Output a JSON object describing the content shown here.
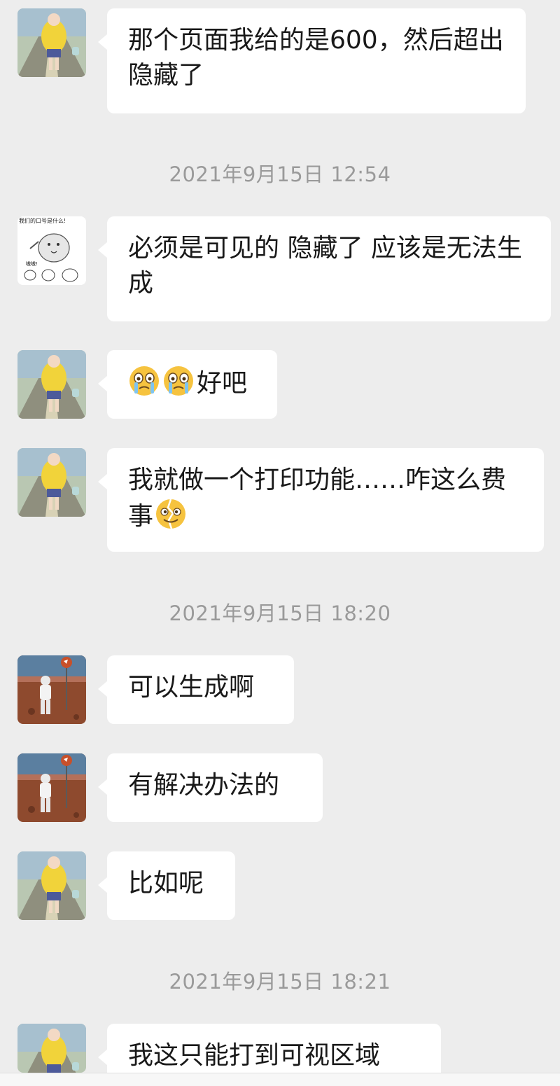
{
  "timestamps": [
    "2021年9月15日 12:54",
    "2021年9月15日 18:20",
    "2021年9月15日 18:21"
  ],
  "messages": [
    {
      "sender": "yellow-coat",
      "text": "那个页面我给的是600，然后超出隐藏了"
    },
    {
      "sender": "sticker-cat",
      "text": "必须是可见的 隐藏了  应该是无法生成"
    },
    {
      "sender": "yellow-coat",
      "emoji": [
        "cry-emoji",
        "cry-emoji"
      ],
      "text": "好吧"
    },
    {
      "sender": "yellow-coat",
      "text": "我就做一个打印功能……咋这么费事",
      "trailing_emoji": "broken-face-emoji"
    },
    {
      "sender": "astronaut",
      "text": "可以生成啊"
    },
    {
      "sender": "astronaut",
      "text": "有解决办法的"
    },
    {
      "sender": "yellow-coat",
      "text": "比如呢"
    },
    {
      "sender": "yellow-coat",
      "text": "我这只能打到可视区域"
    }
  ],
  "stickers": {
    "cat_caption": "我们的口号是什么!",
    "cat_reply": "嗷嗷!"
  },
  "colors": {
    "background": "#ededed",
    "bubble": "#ffffff",
    "timestamp": "#9a9a9a",
    "text": "#191919"
  }
}
